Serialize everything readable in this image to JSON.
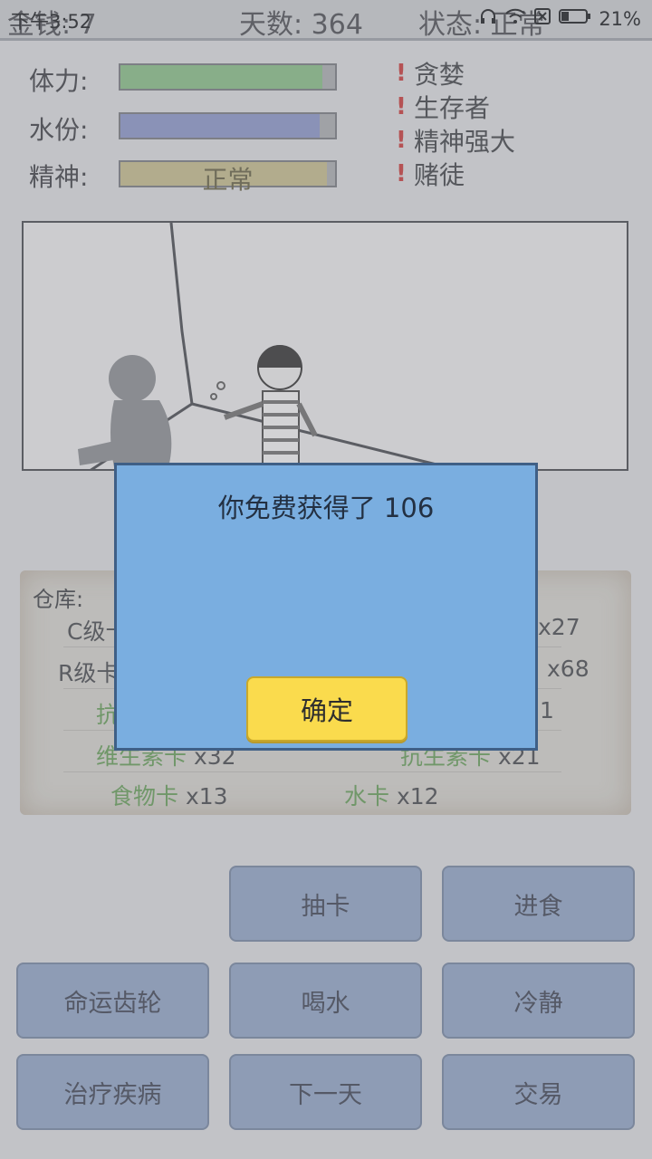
{
  "system": {
    "time": "下午3:52",
    "battery": "21%"
  },
  "header": {
    "money": "金钱: 7",
    "days": "天数: 364",
    "status": "状态: 正常"
  },
  "stats": [
    {
      "label": "体力:",
      "value": 0.94,
      "color": "#8cba8a",
      "text": ""
    },
    {
      "label": "水份:",
      "value": 0.93,
      "color": "#8e98c3",
      "text": ""
    },
    {
      "label": "精神:",
      "value": 0.96,
      "color": "#bfb88f",
      "text": "正常"
    }
  ],
  "traits": [
    "贪婪",
    "生存者",
    "精神强大",
    "赌徒"
  ],
  "storage": {
    "title": "仓库:",
    "rows": [
      {
        "left": {
          "name": "C级卡",
          "count": ""
        },
        "right": {
          "name": "",
          "count": "x27"
        }
      },
      {
        "left": {
          "name": "R级卡",
          "count": ""
        },
        "right": {
          "name": "",
          "count": "x68"
        }
      },
      {
        "left": {
          "name": "抗",
          "count": ""
        },
        "right": {
          "name": "",
          "count": "1"
        }
      },
      {
        "left": {
          "name": "维生素卡",
          "count": "x32"
        },
        "right": {
          "name": "抗生素卡",
          "count": "x21"
        }
      },
      {
        "left": {
          "name": "食物卡",
          "count": "x13"
        },
        "right": {
          "name": "水卡",
          "count": "x12"
        }
      }
    ]
  },
  "buttons": {
    "draw": "抽卡",
    "eat": "进食",
    "fate": "命运齿轮",
    "drink": "喝水",
    "calm": "冷静",
    "treat": "治疗疾病",
    "next_day": "下一天",
    "trade": "交易"
  },
  "dialog": {
    "message": "你免费获得了 106",
    "ok": "确定"
  }
}
